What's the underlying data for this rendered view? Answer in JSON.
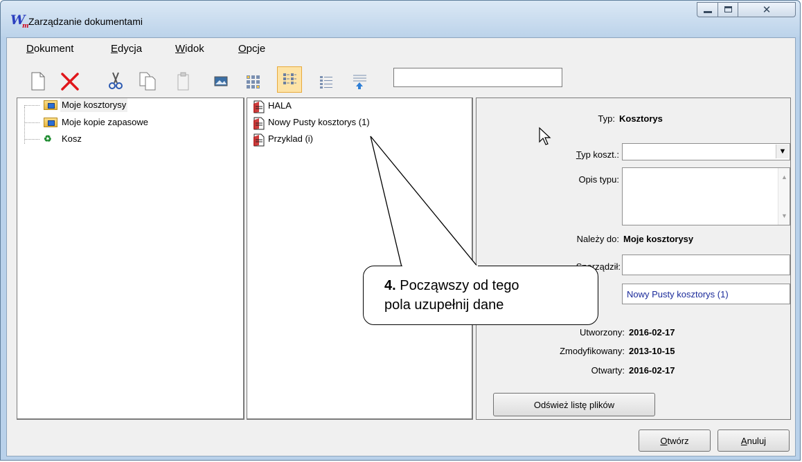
{
  "window": {
    "title": "Zarządzanie dokumentami",
    "app_icon_letter": "W",
    "app_icon_sub": "m",
    "controls": {
      "minimize": "minimize-icon",
      "maximize": "maximize-icon",
      "close": "close-icon",
      "close_glyph": "✕"
    }
  },
  "menu": {
    "items": [
      {
        "first": "D",
        "rest": "okument"
      },
      {
        "first": "E",
        "rest": "dycja"
      },
      {
        "first": "W",
        "rest": "idok"
      },
      {
        "first": "O",
        "rest": "pcje"
      }
    ]
  },
  "toolbar": {
    "buttons": [
      "new-document-icon",
      "delete-icon",
      "cut-icon",
      "copy-icon",
      "paste-icon",
      "image-icon",
      "large-icons-view-icon",
      "small-icons-view-icon",
      "list-view-icon",
      "details-view-icon"
    ],
    "active_button": "small-icons-view-icon",
    "search_value": ""
  },
  "tree": {
    "items": [
      {
        "label": "Moje kosztorysy",
        "icon": "folder-icon",
        "selected": true
      },
      {
        "label": "Moje kopie zapasowe",
        "icon": "folder-icon",
        "selected": false
      },
      {
        "label": "Kosz",
        "icon": "recycle-bin-icon",
        "selected": false
      }
    ]
  },
  "files": {
    "items": [
      {
        "label": "HALA",
        "icon": "document-icon"
      },
      {
        "label": "Nowy Pusty kosztorys (1)",
        "icon": "document-icon"
      },
      {
        "label": "Przyklad (i)",
        "icon": "document-icon"
      }
    ]
  },
  "properties": {
    "typ_label": "Typ:",
    "typ_value": "Kosztorys",
    "typ_koszt_label_first": "T",
    "typ_koszt_label_rest": "yp koszt.:",
    "typ_koszt_value": "",
    "opis_typu_label": "Opis typu:",
    "opis_typu_value": "",
    "nalezy_do_label": "Należy do:",
    "nalezy_do_value": "Moje kosztorysy",
    "sporzadzil_label": "Sporządził:",
    "sporzadzil_value": "",
    "name_value": "Nowy Pusty kosztorys (1)",
    "utworzony_label": "Utworzony:",
    "utworzony_value": "2016-02-17",
    "zmodyfikowany_label": "Zmodyfikowany:",
    "zmodyfikowany_value": "2013-10-15",
    "otwarty_label": "Otwarty:",
    "otwarty_value": "2016-02-17",
    "refresh_button": "Odśwież listę plików"
  },
  "footer": {
    "open_first": "O",
    "open_rest": "twórz",
    "cancel_first": "A",
    "cancel_rest": "nuluj"
  },
  "callout": {
    "number": "4.",
    "text_line1": " Począwszy od tego",
    "text_line2": "pola uzupełnij dane"
  },
  "colors": {
    "titlebar": "#bcd3ea",
    "client": "#f0f0f0",
    "active_tool": "#fde3a6",
    "name_text": "#1a2a9a"
  }
}
